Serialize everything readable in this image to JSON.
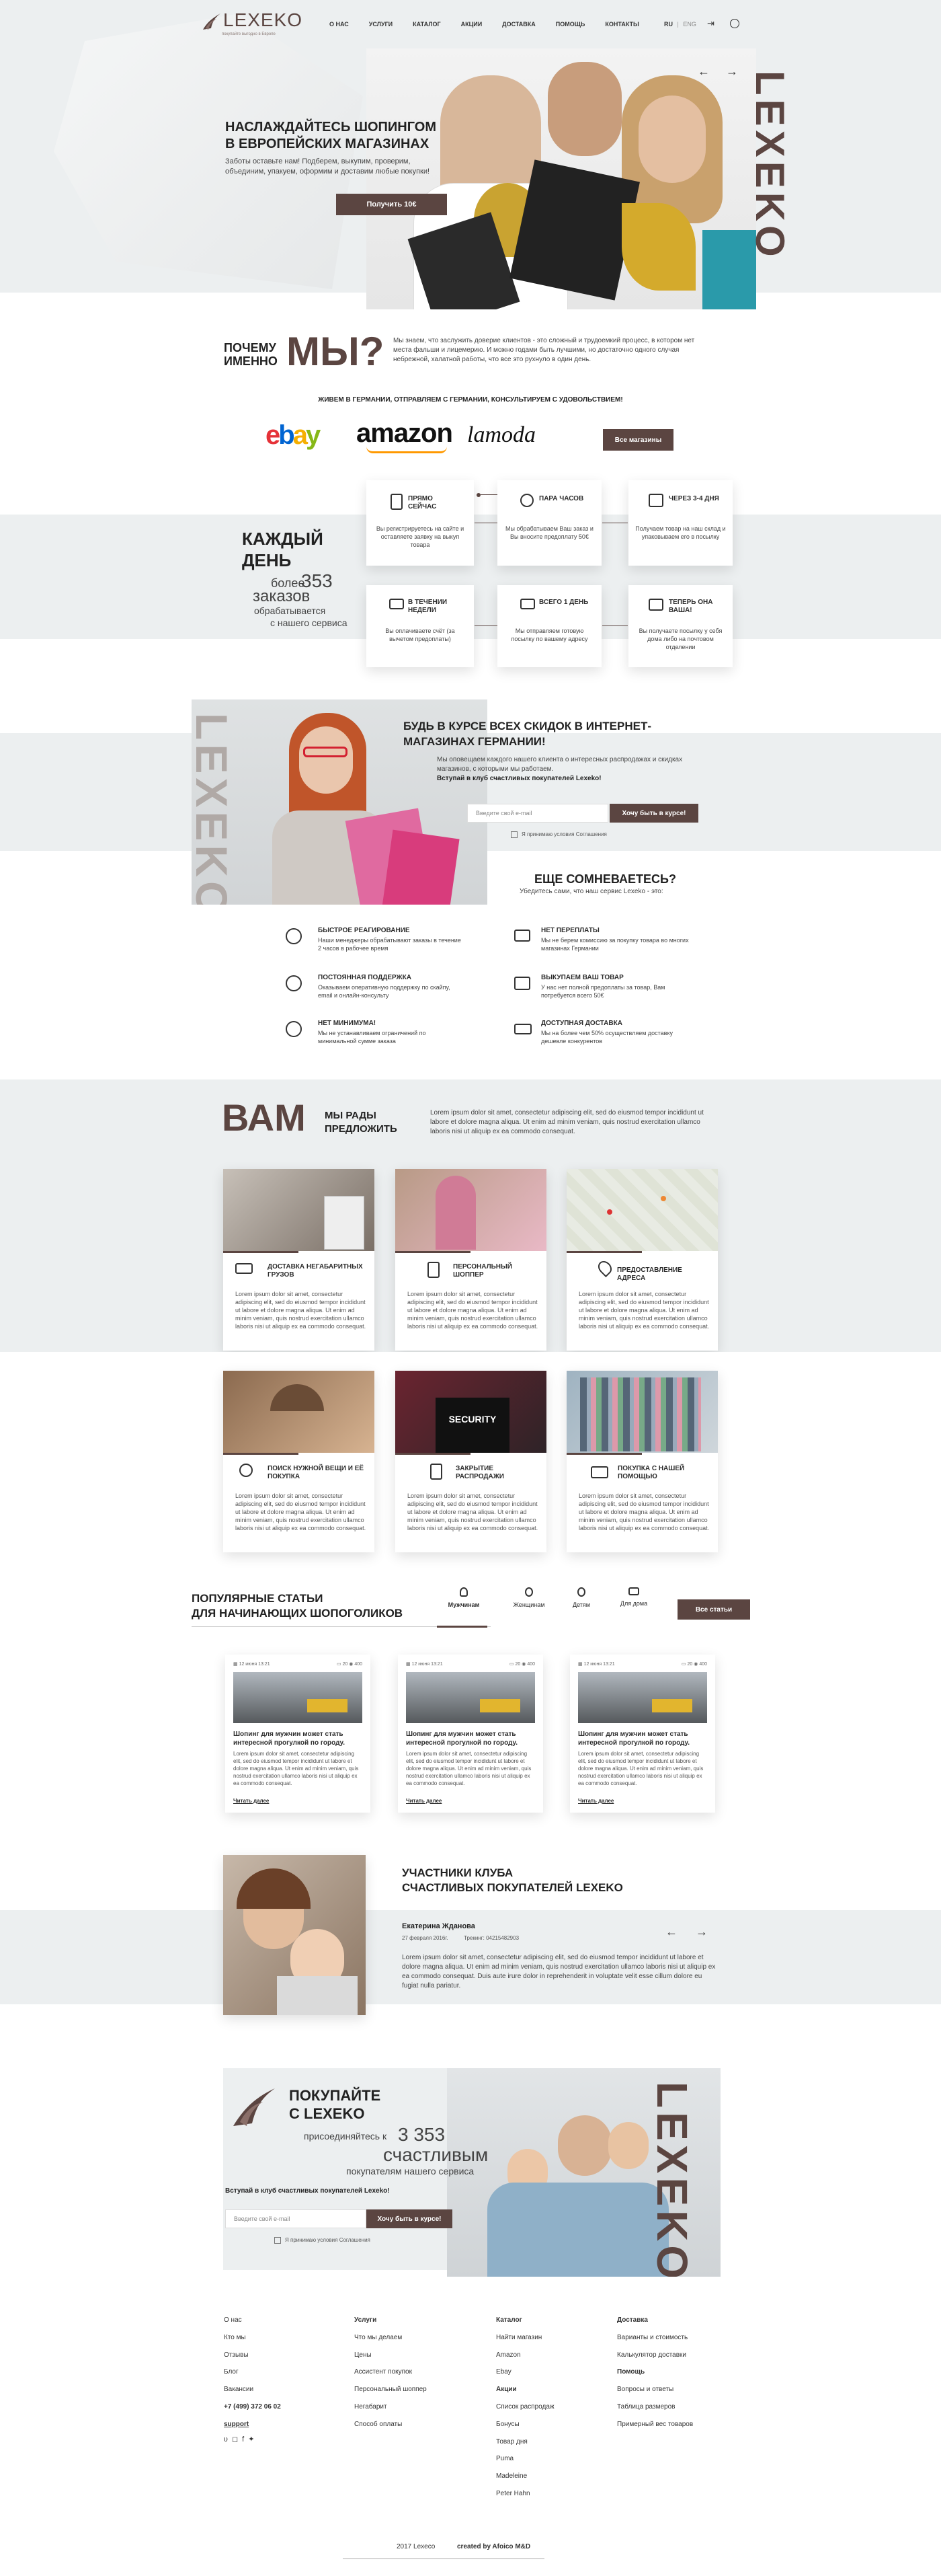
{
  "header": {
    "logo": "LEXEKO",
    "logo_tag": "покупайте выгодно в Европе",
    "nav": [
      "О НАС",
      "УСЛУГИ",
      "КАТАЛОГ",
      "АКЦИИ",
      "ДОСТАВКА",
      "ПОМОЩЬ",
      "КОНТАКТЫ"
    ],
    "lang_ru": "RU",
    "lang_sep": "|",
    "lang_eng": "ENG"
  },
  "hero": {
    "title": "НАСЛАЖДАЙТЕСЬ ШОПИНГОМ В ЕВРОПЕЙСКИХ МАГАЗИНАХ",
    "text": "Заботы оставьте нам! Подберем, выкупим, проверим, объединим, упакуем, оформим и доставим любые покупки!",
    "button": "Получить 10€",
    "vertical": "LEXEKO"
  },
  "why": {
    "q1": "ПОЧЕМУ",
    "q2": "ИМЕННО",
    "big": "МЫ?",
    "text": "Мы знаем, что заслужить доверие клиентов - это сложный и трудоемкий процесс, в котором нет места фальши и лицемерию. И можно годами быть лучшими, но достаточно одного случая небрежной, халатной работы, что все это рухнуло в один день.",
    "tagline": "ЖИВЕМ В ГЕРМАНИИ, ОТПРАВЛЯЕМ С ГЕРМАНИИ, КОНСУЛЬТИРУЕМ С УДОВОЛЬСТВИЕМ!",
    "brands": [
      "ebay",
      "amazon",
      "lamoda"
    ],
    "all_button": "Все магазины"
  },
  "daily": {
    "l1": "КАЖДЫЙ",
    "l2": "ДЕНЬ",
    "more": "более",
    "num": "353",
    "orders": "заказов",
    "sub1": "обрабатывается",
    "sub2": "с нашего сервиса",
    "steps": [
      {
        "t": "ПРЯМО СЕЙЧАС",
        "d": "Вы регистрируетесь на сайте и оставляете заявку на выкуп товара"
      },
      {
        "t": "ПАРА ЧАСОВ",
        "d": "Мы обрабатываем Ваш заказ и Вы вносите предоплату 50€"
      },
      {
        "t": "ЧЕРЕЗ 3-4 ДНЯ",
        "d": "Получаем товар на наш склад и упаковываем его в посылку"
      },
      {
        "t": "В ТЕЧЕНИИ НЕДЕЛИ",
        "d": "Вы оплачиваете счёт (за вычетом предоплаты)"
      },
      {
        "t": "ВСЕГО 1 ДЕНЬ",
        "d": "Мы отправляем готовую посылку по вашему адресу"
      },
      {
        "t": "ТЕПЕРЬ ОНА ВАША!",
        "d": "Вы получаете посылку у себя дома либо на почтовом отделении"
      }
    ]
  },
  "club": {
    "vertical": "LEXEKO",
    "title": "БУДЬ В КУРСЕ ВСЕХ СКИДОК В ИНТЕРНЕТ-МАГАЗИНАХ ГЕРМАНИИ!",
    "text": "Мы оповещаем каждого нашего клиента о интересных распродажах и скидках магазинов, с которыми мы работаем.",
    "bold": "Вступай в клуб счастливых покупателей Lexeko!",
    "placeholder": "Введите свой e-mail",
    "button": "Хочу быть в курсе!",
    "agree": "Я принимаю условия Соглашения"
  },
  "doubt": {
    "title": "ЕЩЕ СОМНЕВАЕТЕСЬ?",
    "sub": "Убедитесь сами, что наш сервис Lexeko - это:",
    "items": [
      {
        "t": "БЫСТРОЕ РЕАГИРОВАНИЕ",
        "d": "Наши менеджеры обрабатывают заказы в течение 2 часов в рабочее время"
      },
      {
        "t": "НЕТ ПЕРЕПЛАТЫ",
        "d": "Мы не берем комиссию за покупку товара во многих магазинах Германии"
      },
      {
        "t": "ПОСТОЯННАЯ ПОДДЕРЖКА",
        "d": "Оказываем оперативную поддержку по скайпу, email и онлайн-консульту"
      },
      {
        "t": "ВЫКУПАЕМ ВАШ ТОВАР",
        "d": "У нас нет полной предоплаты за товар, Вам потребуется всего 50€"
      },
      {
        "t": "НЕТ МИНИМУМА!",
        "d": "Мы не устанавливаем ограничений по минимальной сумме заказа"
      },
      {
        "t": "ДОСТУПНАЯ ДОСТАВКА",
        "d": "Мы на более чем 50% осуществляем доставку дешевле конкурентов"
      }
    ]
  },
  "offer": {
    "big": "ВАМ",
    "l1": "МЫ РАДЫ",
    "l2": "ПРЕДЛОЖИТЬ",
    "text": "Lorem ipsum dolor sit amet, consectetur adipiscing elit, sed do eiusmod tempor incididunt ut labore et dolore magna aliqua. Ut enim ad minim veniam, quis nostrud exercitation ullamco laboris nisi ut aliquip ex ea commodo consequat.",
    "cards": [
      {
        "t": "ДОСТАВКА НЕГАБАРИТНЫХ ГРУЗОВ"
      },
      {
        "t": "ПЕРСОНАЛЬНЫЙ ШОППЕР"
      },
      {
        "t": "ПРЕДОСТАВЛЕНИЕ АДРЕСА"
      },
      {
        "t": "ПОИСК НУЖНОЙ ВЕЩИ И ЕЁ ПОКУПКА"
      },
      {
        "t": "ЗАКРЫТИЕ РАСПРОДАЖИ"
      },
      {
        "t": "ПОКУПКА С НАШЕЙ ПОМОЩЬЮ"
      }
    ],
    "card_text": "Lorem ipsum dolor sit amet, consectetur adipiscing elit, sed do eiusmod tempor incididunt ut labore et dolore magna aliqua. Ut enim ad minim veniam, quis nostrud exercitation ullamco laboris nisi ut aliquip ex ea commodo consequat."
  },
  "articles": {
    "t1": "ПОПУЛЯРНЫЕ СТАТЬИ",
    "t2": "ДЛЯ НАЧИНАЮЩИХ ШОПОГОЛИКОВ",
    "tabs": [
      "Мужчинам",
      "Женщинам",
      "Детям",
      "Для дома"
    ],
    "all": "Все статьи",
    "date": "12 июня 13:21",
    "comments": "20",
    "views": "400",
    "title": "Шопинг для мужчин может стать интересной прогулкой по городу.",
    "text": "Lorem ipsum dolor sit amet, consectetur adipiscing elit, sed do eiusmod tempor incididunt ut labore et dolore magna aliqua. Ut enim ad minim veniam, quis nostrud exercitation ullamco laboris nisi ut aliquip ex ea commodo consequat.",
    "more": "Читать далее"
  },
  "members": {
    "t1": "УЧАСТНИКИ КЛУБА",
    "t2": "СЧАСТЛИВЫХ ПОКУПАТЕЛЕЙ LEXEKO",
    "name": "Екатерина Жданова",
    "date": "27 февраля 2016г.",
    "track": "Трекинг: 04215482903",
    "text": "Lorem ipsum dolor sit amet, consectetur adipiscing elit, sed do eiusmod tempor incididunt ut labore et dolore magna aliqua. Ut enim ad minim veniam, quis nostrud exercitation ullamco laboris nisi ut aliquip ex ea commodo consequat. Duis aute irure dolor in reprehenderit in voluptate velit esse cillum dolore eu fugiat nulla pariatur."
  },
  "cta": {
    "t1": "ПОКУПАЙТЕ",
    "t2": "С LEXEKO",
    "join": "присоединяйтесь к",
    "num": "3 353",
    "happy": "счастливым",
    "sub": "покупателям нашего сервиса",
    "bold": "Вступай в клуб счастливых покупателей Lexeko!",
    "placeholder": "Введите свой e-mail",
    "button": "Хочу быть в курсе!",
    "agree": "Я принимаю условия Соглашения",
    "vertical": "LEXEKO"
  },
  "footer": {
    "col1": [
      "О нас",
      "Кто мы",
      "Отзывы",
      "Блог",
      "Вакансии",
      "+7 (499) 372 06 02",
      "support"
    ],
    "col2": [
      "Услуги",
      "Что мы делаем",
      "Цены",
      "Ассистент покупок",
      "Персональный шоппер",
      "Негабарит",
      "Способ оплаты"
    ],
    "col3": [
      "Каталог",
      "Найти магазин",
      "Amazon",
      "Ebay",
      "Акции",
      "Список распродаж",
      "Бонусы",
      "Товар дня",
      "Puma",
      "Madeleine",
      "Peter Hahn"
    ],
    "col4": [
      "Доставка",
      "Варианты и стоимость",
      "Калькулятор доставки",
      "Помощь",
      "Вопросы и ответы",
      "Таблица размеров",
      "Примерный вес товаров"
    ],
    "copy": "2017 Lexeco",
    "created": "created by Afoico M&D"
  },
  "colors": {
    "accent": "#5b4541",
    "bg_gray": "#eceff0",
    "btn": "#5b4541"
  }
}
